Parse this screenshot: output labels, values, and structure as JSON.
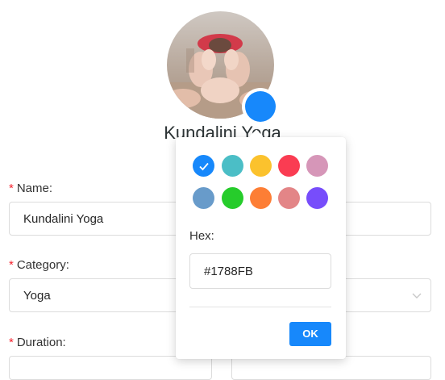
{
  "profile": {
    "name": "Kundalini Yoga",
    "selected_color": "#1788FB",
    "avatar_image": "yoga-feet-photo"
  },
  "form": {
    "name": {
      "label": "Name:",
      "value": "Kundalini Yoga",
      "required_mark": "*"
    },
    "category": {
      "label": "Category:",
      "value": "Yoga",
      "required_mark": "*"
    },
    "duration": {
      "label": "Duration:",
      "required_mark": "*"
    }
  },
  "color_picker": {
    "swatches": [
      {
        "color": "#1788fb",
        "selected": true,
        "icon": "check-icon"
      },
      {
        "color": "#4bbec6",
        "selected": false
      },
      {
        "color": "#fbc22d",
        "selected": false
      },
      {
        "color": "#fa3c52",
        "selected": false
      },
      {
        "color": "#d696b8",
        "selected": false
      },
      {
        "color": "#689bca",
        "selected": false
      },
      {
        "color": "#26cc2b",
        "selected": false
      },
      {
        "color": "#fd7e35",
        "selected": false
      },
      {
        "color": "#e38587",
        "selected": false
      },
      {
        "color": "#774dfb",
        "selected": false
      }
    ],
    "hex_label": "Hex:",
    "hex_value": "#1788FB",
    "ok_label": "OK"
  }
}
